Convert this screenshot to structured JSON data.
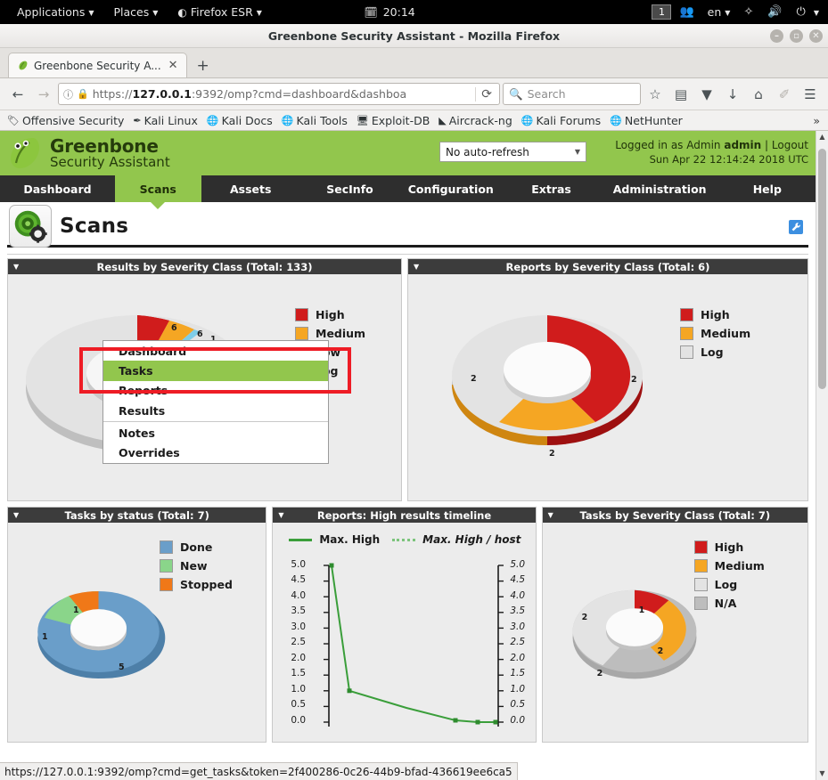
{
  "desktop": {
    "applications": "Applications",
    "places": "Places",
    "firefox": "Firefox ESR",
    "clock": "20:14",
    "workspace": "1",
    "language": "en"
  },
  "window": {
    "title": "Greenbone Security Assistant - Mozilla Firefox",
    "minimize": "–",
    "maximize": "▫",
    "close": "✕"
  },
  "tabs": {
    "items": [
      {
        "title": "Greenbone Security A...",
        "close": "✕"
      }
    ],
    "newtab": "+"
  },
  "navbar": {
    "back": "←",
    "forward": "→",
    "url_prefix": "https://",
    "url_host": "127.0.0.1",
    "url_rest": ":9392/omp?cmd=dashboard&dashboa",
    "reload": "⟳",
    "search_placeholder": "Search",
    "bookmark_star": "☆",
    "library": "▤",
    "pocket": "▼",
    "downloads": "↓",
    "home": "⌂",
    "sync": "✐",
    "menu": "☰"
  },
  "bookmarks": {
    "items": [
      {
        "label": "Offensive Security",
        "icon": "offsec-icon"
      },
      {
        "label": "Kali Linux",
        "icon": "dragon-icon"
      },
      {
        "label": "Kali Docs",
        "icon": "globe-icon"
      },
      {
        "label": "Kali Tools",
        "icon": "globe-icon"
      },
      {
        "label": "Exploit-DB",
        "icon": "exploitdb-icon"
      },
      {
        "label": "Aircrack-ng",
        "icon": "aircrack-icon"
      },
      {
        "label": "Kali Forums",
        "icon": "globe-icon"
      },
      {
        "label": "NetHunter",
        "icon": "globe-icon"
      }
    ],
    "overflow": "»"
  },
  "gsa": {
    "brand_line1": "Greenbone",
    "brand_line2": "Security Assistant",
    "refresh_value": "No auto-refresh",
    "logged_in_prefix": "Logged in as",
    "role": "Admin",
    "user": "admin",
    "separator": "|",
    "logout": "Logout",
    "datetime": "Sun Apr 22 12:14:24 2018 UTC",
    "nav": [
      {
        "label": "Dashboard",
        "active": false
      },
      {
        "label": "Scans",
        "active": true
      },
      {
        "label": "Assets",
        "active": false
      },
      {
        "label": "SecInfo",
        "active": false
      },
      {
        "label": "Configuration",
        "active": false
      },
      {
        "label": "Extras",
        "active": false
      },
      {
        "label": "Administration",
        "active": false
      },
      {
        "label": "Help",
        "active": false
      }
    ],
    "page_title": "Scans",
    "menu": {
      "items": [
        {
          "label": "Dashboard",
          "selected": false,
          "sep_after": false
        },
        {
          "label": "Tasks",
          "selected": true,
          "sep_after": false
        },
        {
          "label": "Reports",
          "selected": false,
          "sep_after": false
        },
        {
          "label": "Results",
          "selected": false,
          "sep_after": true
        },
        {
          "label": "Notes",
          "selected": false,
          "sep_after": false
        },
        {
          "label": "Overrides",
          "selected": false,
          "sep_after": false
        }
      ]
    }
  },
  "colors": {
    "high": "#d01c1c",
    "medium": "#f5a623",
    "low": "#7fcde8",
    "log": "#e3e3e3",
    "na": "#bdbdbd",
    "done": "#6a9ec9",
    "new": "#8ad58a",
    "stopped": "#f07818",
    "line": "#3a9e3a",
    "brand": "#92c64d"
  },
  "chart_data": [
    {
      "id": "results-by-severity",
      "type": "pie",
      "title": "Results by Severity Class (Total: 133)",
      "title_visible_fragment": "R",
      "labels": [
        "High",
        "Medium",
        "Low",
        "Log"
      ],
      "values": [
        6,
        6,
        1,
        120
      ],
      "colors": [
        "#d01c1c",
        "#f5a623",
        "#7fcde8",
        "#e3e3e3"
      ],
      "legend": "right"
    },
    {
      "id": "reports-by-severity",
      "type": "pie",
      "title": "Reports by Severity Class (Total: 6)",
      "labels": [
        "High",
        "Medium",
        "Log"
      ],
      "values": [
        2,
        2,
        2
      ],
      "colors": [
        "#d01c1c",
        "#f5a623",
        "#e3e3e3"
      ],
      "legend": "right"
    },
    {
      "id": "tasks-by-status",
      "type": "pie",
      "title": "Tasks by status (Total: 7)",
      "labels": [
        "Done",
        "New",
        "Stopped"
      ],
      "values": [
        5,
        1,
        1
      ],
      "colors": [
        "#6a9ec9",
        "#8ad58a",
        "#f07818"
      ],
      "legend": "right"
    },
    {
      "id": "high-results-timeline",
      "type": "line",
      "title": "Reports: High results timeline",
      "series": [
        {
          "name": "Max. High",
          "style": "solid",
          "values": [
            5.0,
            1.0,
            0.55,
            0.1,
            0.0,
            0.0
          ]
        },
        {
          "name": "Max. High / host",
          "style": "dotted",
          "values": [
            0,
            0,
            0,
            0,
            0,
            0
          ]
        }
      ],
      "yticks_left": [
        "5.0",
        "4.5",
        "4.0",
        "3.5",
        "3.0",
        "2.5",
        "2.0",
        "1.5",
        "1.0",
        "0.5",
        "0.0"
      ],
      "yticks_right": [
        "5.0",
        "4.5",
        "4.0",
        "3.5",
        "3.0",
        "2.5",
        "2.0",
        "1.5",
        "1.0",
        "0.5",
        "0.0"
      ],
      "ylim": [
        0,
        5
      ],
      "grid": false,
      "legend": "top"
    },
    {
      "id": "tasks-by-severity",
      "type": "pie",
      "title": "Tasks by Severity Class (Total: 7)",
      "labels": [
        "High",
        "Medium",
        "Log",
        "N/A"
      ],
      "values": [
        1,
        2,
        2,
        2
      ],
      "colors": [
        "#d01c1c",
        "#f5a623",
        "#e3e3e3",
        "#bdbdbd"
      ],
      "legend": "right"
    }
  ],
  "statusbar": {
    "url": "https://127.0.0.1:9392/omp?cmd=get_tasks&token=2f400286-0c26-44b9-bfad-436619ee6ca5"
  }
}
